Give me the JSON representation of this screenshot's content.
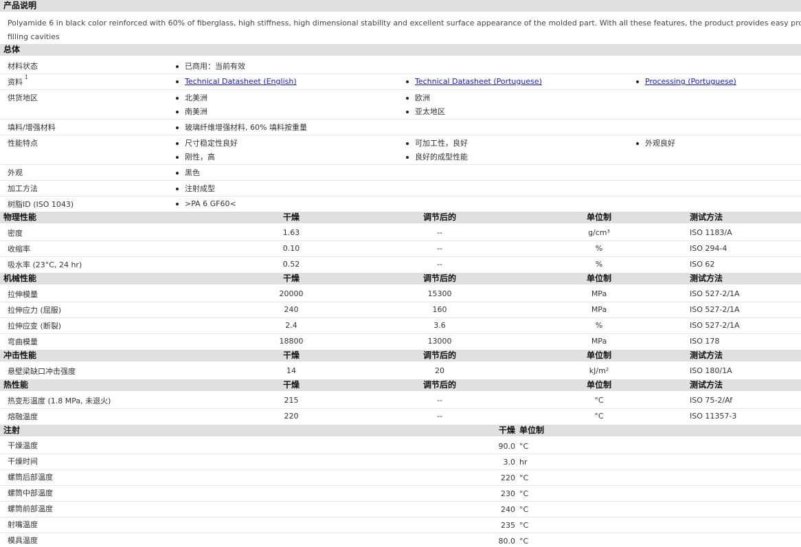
{
  "product_description": {
    "title": "产品说明",
    "text_line1": "Polyamide 6 in black color reinforced with 60% of fiberglass, high stiffness, high dimensional stability and excellent surface appearance of the molded part. With all these features, the product provides easy process",
    "text_line2": "filling cavities"
  },
  "general": {
    "title": "总体",
    "material_status": {
      "label": "材料状态",
      "value": "已商用：当前有效"
    },
    "resources": {
      "label": "资料",
      "footnote": "1",
      "links": [
        "Technical Datasheet (English)",
        "Technical Datasheet (Portuguese)",
        "Processing (Portuguese)"
      ]
    },
    "availability": {
      "label": "供货地区",
      "values": [
        "北美洲",
        "欧洲",
        "南美洲",
        "亚太地区"
      ]
    },
    "filler": {
      "label": "填料/增强材料",
      "value": "玻璃纤维增强材料, 60% 填料按重量"
    },
    "features": {
      "label": "性能特点",
      "values": [
        "尺寸稳定性良好",
        "可加工性，良好",
        "外观良好",
        "刚性，高",
        "良好的成型性能"
      ]
    },
    "appearance": {
      "label": "外观",
      "value": "黑色"
    },
    "processing_method": {
      "label": "加工方法",
      "value": "注射成型"
    },
    "resin_id": {
      "label": "树脂ID (ISO 1043)",
      "value": ">PA 6 GF60<"
    }
  },
  "columns": {
    "dry": "干燥",
    "conditioned": "调节后的",
    "unit": "单位制",
    "test_method": "测试方法"
  },
  "physical": {
    "title": "物理性能",
    "rows": [
      {
        "name": "密度",
        "dry": "1.63",
        "cond": "--",
        "unit": "g/cm³",
        "method": "ISO 1183/A"
      },
      {
        "name": "收缩率",
        "dry": "0.10",
        "cond": "--",
        "unit": "%",
        "method": "ISO 294-4"
      },
      {
        "name": "吸水率 (23°C, 24 hr)",
        "dry": "0.52",
        "cond": "--",
        "unit": "%",
        "method": "ISO 62"
      }
    ]
  },
  "mechanical": {
    "title": "机械性能",
    "rows": [
      {
        "name": "拉伸模量",
        "dry": "20000",
        "cond": "15300",
        "unit": "MPa",
        "method": "ISO 527-2/1A"
      },
      {
        "name": "拉伸应力 (屈服)",
        "dry": "240",
        "cond": "160",
        "unit": "MPa",
        "method": "ISO 527-2/1A"
      },
      {
        "name": "拉伸应变 (断裂)",
        "dry": "2.4",
        "cond": "3.6",
        "unit": "%",
        "method": "ISO 527-2/1A"
      },
      {
        "name": "弯曲模量",
        "dry": "18800",
        "cond": "13000",
        "unit": "MPa",
        "method": "ISO 178"
      }
    ]
  },
  "impact": {
    "title": "冲击性能",
    "rows": [
      {
        "name": "悬壁梁缺口冲击强度",
        "dry": "14",
        "cond": "20",
        "unit": "kJ/m²",
        "method": "ISO 180/1A"
      }
    ]
  },
  "thermal": {
    "title": "热性能",
    "rows": [
      {
        "name": "热变形温度 (1.8 MPa, 未退火)",
        "dry": "215",
        "cond": "--",
        "unit": "°C",
        "method": "ISO 75-2/Af"
      },
      {
        "name": "熔融温度",
        "dry": "220",
        "cond": "--",
        "unit": "°C",
        "method": "ISO 11357-3"
      }
    ]
  },
  "injection": {
    "title": "注射",
    "col_dry": "干燥",
    "col_unit": "单位制",
    "rows": [
      {
        "name": "干燥温度",
        "value": "90.0",
        "unit": "°C"
      },
      {
        "name": "干燥时间",
        "value": "3.0",
        "unit": "hr"
      },
      {
        "name": "螺筒后部温度",
        "value": "220",
        "unit": "°C"
      },
      {
        "name": "螺筒中部温度",
        "value": "230",
        "unit": "°C"
      },
      {
        "name": "螺筒前部温度",
        "value": "240",
        "unit": "°C"
      },
      {
        "name": "射嘴温度",
        "value": "235",
        "unit": "°C"
      },
      {
        "name": "模具温度",
        "value": "80.0",
        "unit": "°C"
      }
    ]
  }
}
